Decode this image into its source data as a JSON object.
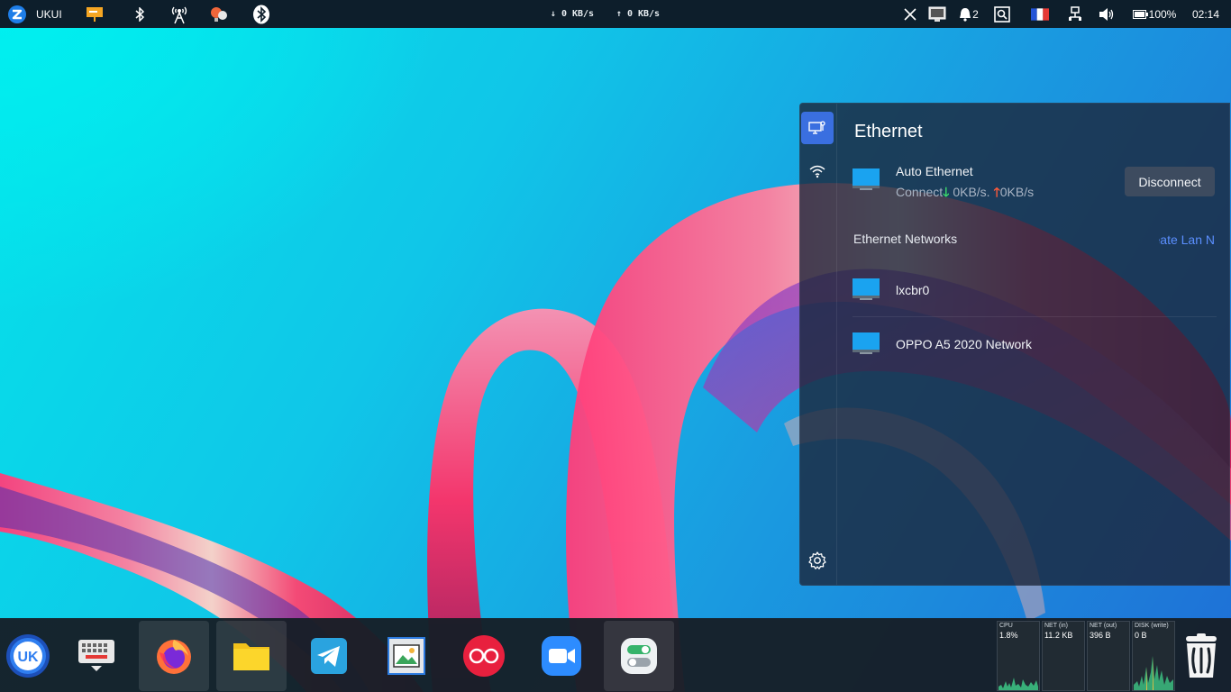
{
  "top_panel": {
    "start_label": "UKUI",
    "net_down": "↓ 0 KB/s",
    "net_up": "↑ 0 KB/s",
    "notification_count": "2",
    "battery": "100%",
    "clock": "02:14"
  },
  "network_panel": {
    "title": "Ethernet",
    "active_connection": {
      "name": "Auto Ethernet",
      "status": "Connect",
      "down": "0KB/s.",
      "up": "0KB/s",
      "button": "Disconnect"
    },
    "section_label": "Ethernet Networks",
    "create_link": "eate Lan N",
    "networks": [
      {
        "name": "lxcbr0"
      },
      {
        "name": "OPPO A5 2020 Network"
      }
    ]
  },
  "dock": {
    "apps": [
      {
        "icon": "ukui-start-icon"
      },
      {
        "icon": "virtual-keyboard-icon"
      },
      {
        "icon": "firefox-icon"
      },
      {
        "icon": "file-manager-icon"
      },
      {
        "icon": "telegram-icon"
      },
      {
        "icon": "image-viewer-icon"
      },
      {
        "icon": "flickr-icon"
      },
      {
        "icon": "zoom-icon"
      },
      {
        "icon": "settings-toggle-icon"
      }
    ],
    "monitors": [
      {
        "label": "CPU",
        "value": "1.8%"
      },
      {
        "label": "NET (in)",
        "value": "11.2 KB"
      },
      {
        "label": "NET (out)",
        "value": "396 B"
      },
      {
        "label": "DISK (write)",
        "value": "0 B"
      }
    ]
  },
  "colors": {
    "accent": "#3a6fe0",
    "link": "#5b8fff",
    "monitor_graph": "#3fd28b"
  }
}
